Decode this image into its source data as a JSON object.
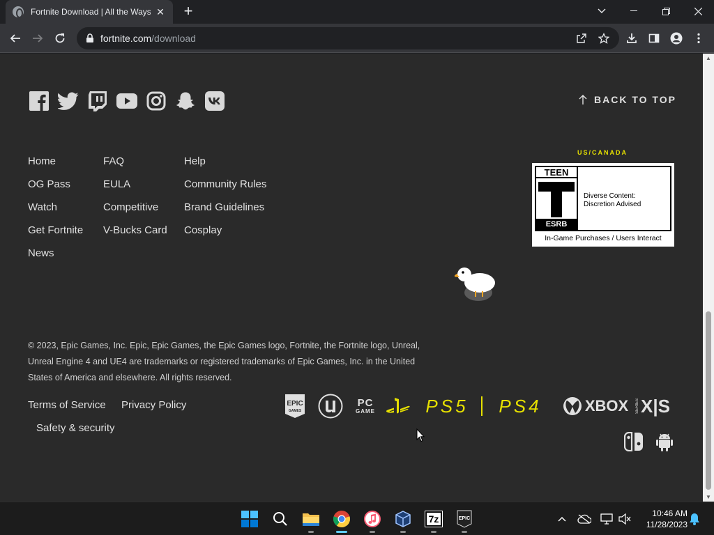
{
  "browser": {
    "tab_title": "Fortnite Download | All the Ways to",
    "url_host": "fortnite.com",
    "url_path": "/download"
  },
  "page": {
    "back_to_top": "BACK TO TOP",
    "social": [
      "facebook-icon",
      "twitter-icon",
      "twitch-icon",
      "youtube-icon",
      "instagram-icon",
      "snapchat-icon",
      "vk-icon"
    ],
    "nav_col1": [
      "Home",
      "OG Pass",
      "Watch",
      "Get Fortnite",
      "News"
    ],
    "nav_col2": [
      "FAQ",
      "EULA",
      "Competitive",
      "V-Bucks Card"
    ],
    "nav_col3": [
      "Help",
      "Community Rules",
      "Brand Guidelines",
      "Cosplay"
    ],
    "rating": {
      "region": "US/CANADA",
      "teen": "TEEN",
      "letter": "T",
      "esrb": "ESRB",
      "descriptor_line1": "Diverse Content:",
      "descriptor_line2": "Discretion Advised",
      "interactive": "In-Game Purchases / Users Interact"
    },
    "copyright": "© 2023, Epic Games, Inc. Epic, Epic Games, the Epic Games logo, Fortnite, the Fortnite logo, Unreal, Unreal Engine 4 and UE4 are trademarks or registered trademarks of Epic Games, Inc. in the United States of America and elsewhere. All rights reserved.",
    "legal": {
      "terms": "Terms of Service",
      "privacy": "Privacy Policy",
      "safety": "Safety & security"
    },
    "platforms": {
      "epic": "EPIC",
      "epic_sub": "GAMES",
      "pc_top": "PC",
      "pc_bottom": "GAME",
      "ps5": "PS5",
      "ps4": "PS4",
      "xbox": "XBOX",
      "xbox_series": "SERIES",
      "xs": "X|S"
    }
  },
  "taskbar": {
    "time": "10:46 AM",
    "date": "11/28/2023",
    "zip_label": "7z",
    "epic_label": "EPIC"
  },
  "colors": {
    "accent_yellow": "#e6e000",
    "page_bg": "#2a2a2a",
    "taskbar_active": "#60cdff"
  }
}
